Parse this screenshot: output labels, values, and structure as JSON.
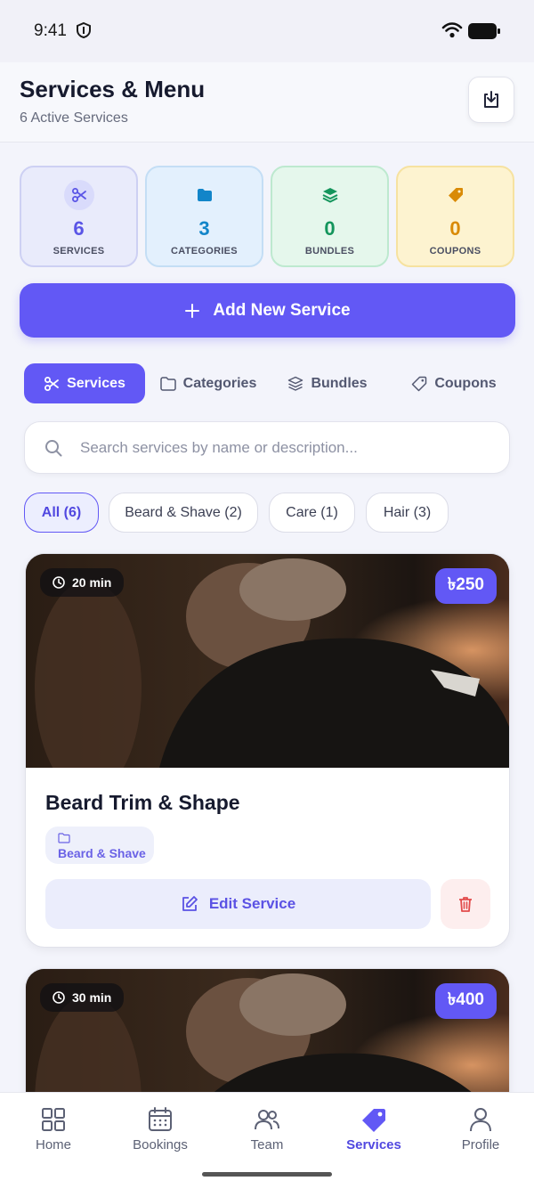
{
  "status_bar": {
    "time": "9:41"
  },
  "header": {
    "title": "Services & Menu",
    "subtitle": "6 Active Services"
  },
  "stats": [
    {
      "value": "6",
      "label": "SERVICES",
      "icon": "scissors-icon",
      "color": "#5a55e6"
    },
    {
      "value": "3",
      "label": "CATEGORIES",
      "icon": "folder-icon",
      "color": "#1285c9"
    },
    {
      "value": "0",
      "label": "BUNDLES",
      "icon": "layers-icon",
      "color": "#14955c"
    },
    {
      "value": "0",
      "label": "COUPONS",
      "icon": "tag-icon",
      "color": "#d98a06"
    }
  ],
  "add_button": {
    "label": "Add New Service"
  },
  "tabs": [
    {
      "label": "Services",
      "active": true
    },
    {
      "label": "Categories"
    },
    {
      "label": "Bundles"
    },
    {
      "label": "Coupons"
    }
  ],
  "search": {
    "placeholder": "Search services by name or description..."
  },
  "filters": [
    {
      "label": "All (6)",
      "active": true
    },
    {
      "label": "Beard & Shave (2)"
    },
    {
      "label": "Care (1)"
    },
    {
      "label": "Hair (3)"
    }
  ],
  "services": [
    {
      "title": "Beard Trim & Shape",
      "duration": "20 min",
      "price": "৳250",
      "category": "Beard & Shave",
      "edit_label": "Edit Service"
    },
    {
      "duration": "30 min",
      "price": "৳400"
    }
  ],
  "bottom_nav": [
    {
      "label": "Home"
    },
    {
      "label": "Bookings"
    },
    {
      "label": "Team"
    },
    {
      "label": "Services",
      "active": true
    },
    {
      "label": "Profile"
    }
  ],
  "colors": {
    "accent": "#6258f5",
    "danger": "#e24b4b"
  }
}
